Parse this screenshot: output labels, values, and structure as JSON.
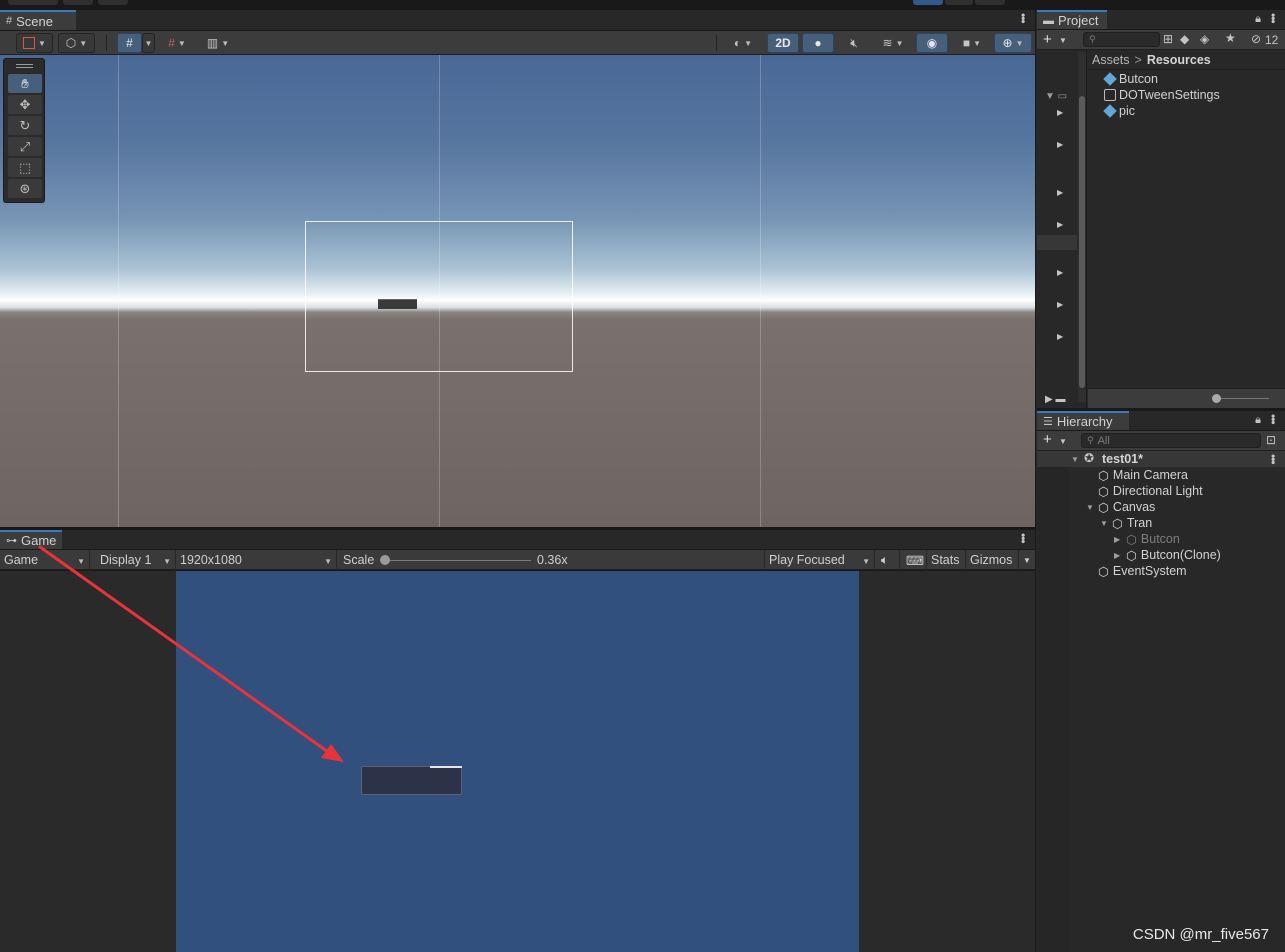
{
  "scene": {
    "tab_label": "Scene",
    "toolbar": {
      "mode_2d_label": "2D"
    }
  },
  "game": {
    "tab_label": "Game",
    "view_select": "Game",
    "display_select": "Display 1",
    "resolution_select": "1920x1080",
    "scale_label": "Scale",
    "scale_value": "0.36x",
    "play_mode_select": "Play Focused",
    "stats_label": "Stats",
    "gizmos_label": "Gizmos"
  },
  "project": {
    "tab_label": "Project",
    "hidden_count": "12",
    "breadcrumb": {
      "root": "Assets",
      "sep": ">",
      "current": "Resources"
    },
    "assets": [
      {
        "name": "Butcon",
        "icon": "prefab-icon"
      },
      {
        "name": "DOTweenSettings",
        "icon": "scriptable-object-icon"
      },
      {
        "name": "pic",
        "icon": "prefab-icon"
      }
    ]
  },
  "hierarchy": {
    "tab_label": "Hierarchy",
    "search_placeholder": "All",
    "scene_name": "test01*",
    "items": [
      {
        "label": "Main Camera"
      },
      {
        "label": "Directional Light"
      },
      {
        "label": "Canvas"
      },
      {
        "label": "Tran"
      },
      {
        "label": "Butcon"
      },
      {
        "label": "Butcon(Clone)"
      },
      {
        "label": "EventSystem"
      }
    ]
  },
  "watermark": "CSDN @mr_five567",
  "colors": {
    "accent": "#3a79bb",
    "active_tool": "#46607c",
    "game_canvas": "#31507d",
    "annotation_arrow": "#e8333a"
  }
}
